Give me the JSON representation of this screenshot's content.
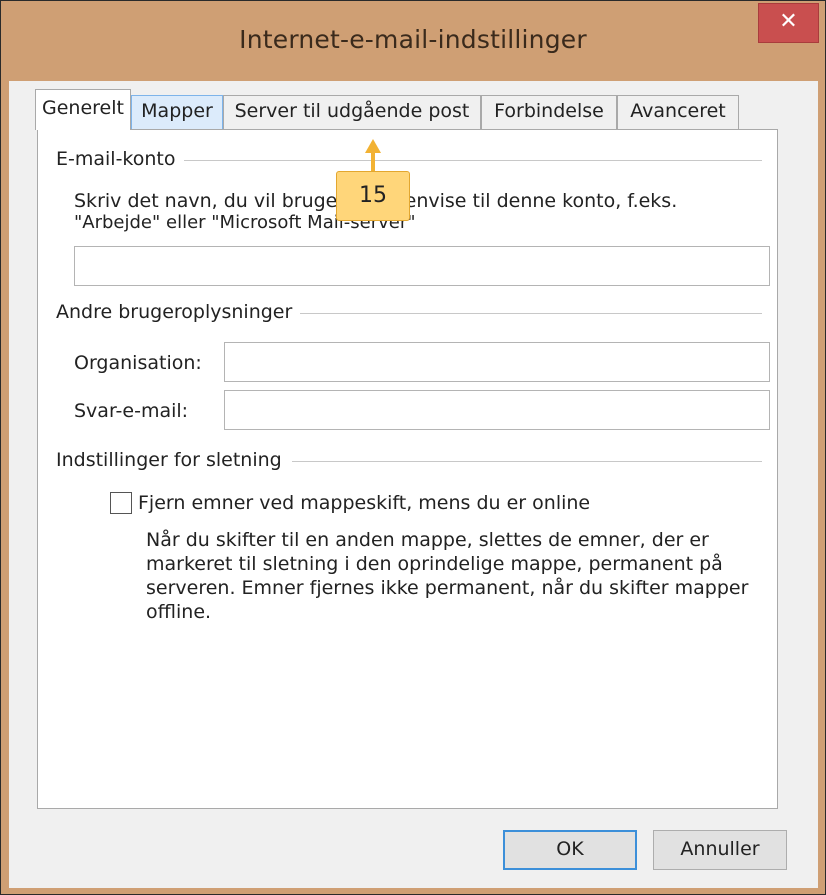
{
  "window": {
    "title": "Internet-e-mail-indstillinger",
    "close_glyph": "✕",
    "close_color": "#c94f4f"
  },
  "tabs": [
    {
      "label": "Generelt",
      "state": "active"
    },
    {
      "label": "Mapper",
      "state": "hover"
    },
    {
      "label": "Server til udgående post",
      "state": "normal"
    },
    {
      "label": "Forbindelse",
      "state": "normal"
    },
    {
      "label": "Avanceret",
      "state": "normal"
    }
  ],
  "email_account": {
    "heading": "E-mail-konto",
    "description_line1": "Skriv det navn, du vil bruge til at henvise til denne konto, f.eks.",
    "description_line2": "\"Arbejde\" eller \"Microsoft Mail-server\"",
    "name_value": ""
  },
  "user_info": {
    "heading": "Andre brugeroplysninger",
    "organisation_label": "Organisation:",
    "organisation_value": "",
    "reply_label": "Svar-e-mail:",
    "reply_value": ""
  },
  "delete_settings": {
    "heading": "Indstillinger for sletning",
    "checkbox_label": "Fjern emner ved mappeskift, mens du er online",
    "checked": false,
    "description": [
      "Når du skifter til en anden mappe, slettes de emner, der er",
      "markeret til sletning i den oprindelige mappe, permanent på",
      "serveren. Emner fjernes ikke permanent, når du skifter mapper",
      "offline."
    ]
  },
  "buttons": {
    "ok": "OK",
    "cancel": "Annuller"
  },
  "callout": {
    "label": "15",
    "color": "#ffd67a"
  }
}
